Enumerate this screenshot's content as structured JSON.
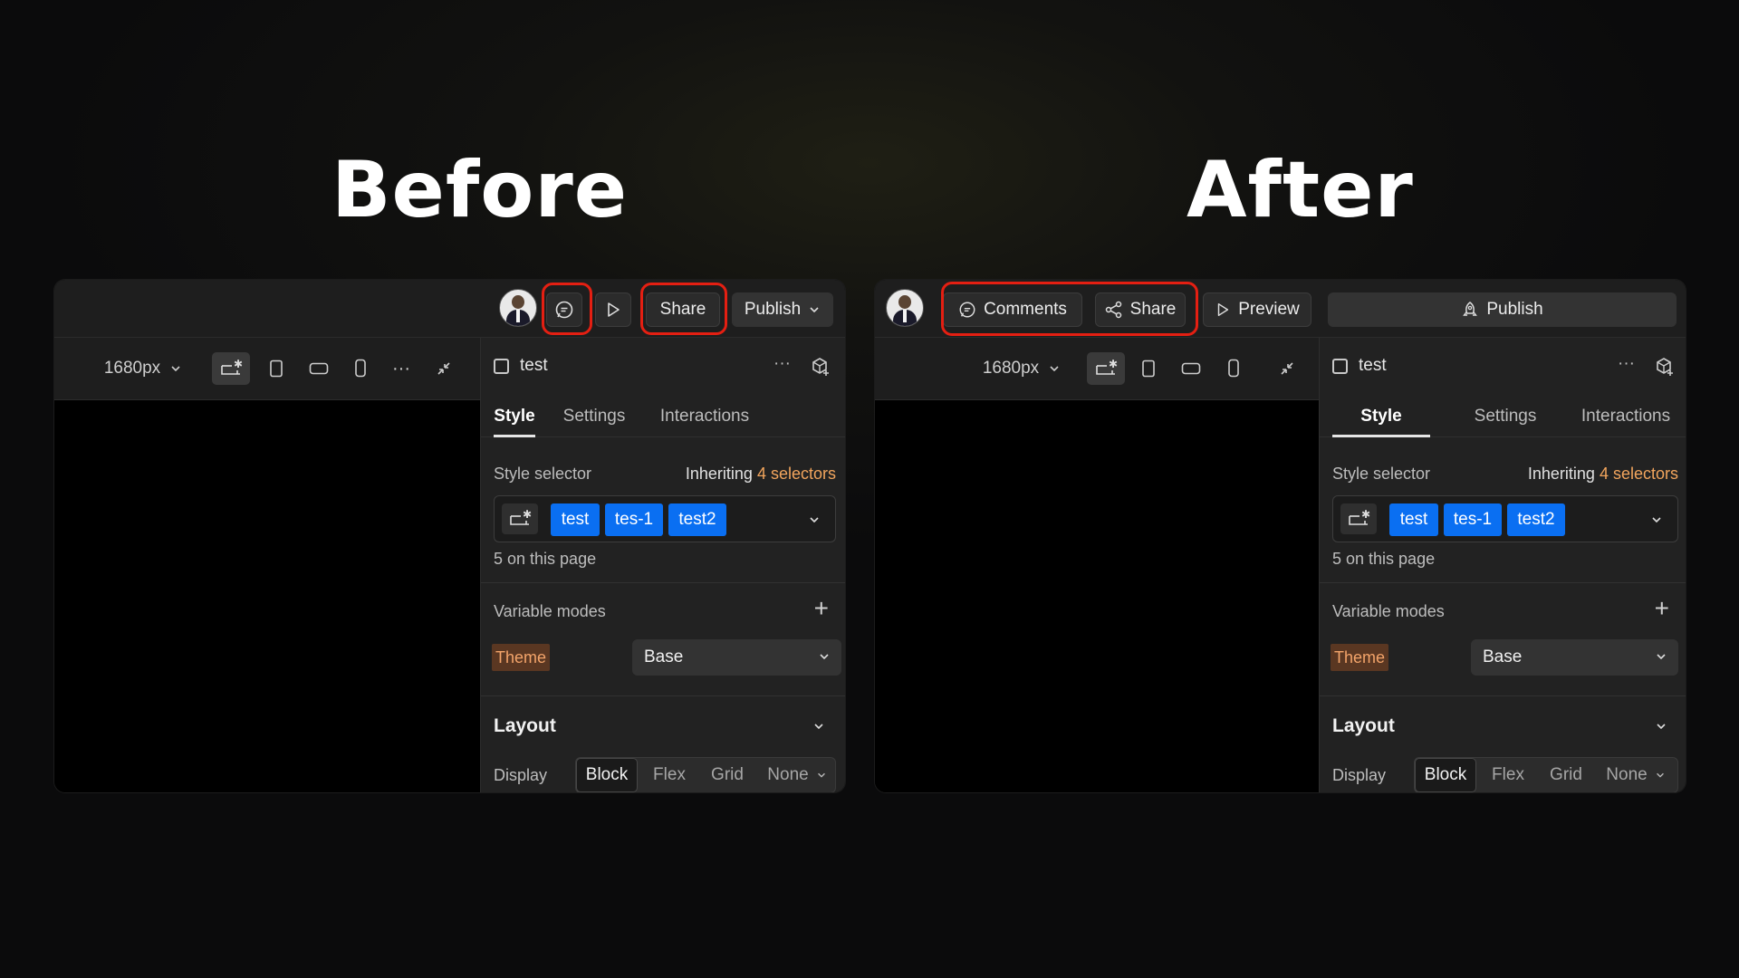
{
  "headings": {
    "before": "Before",
    "after": "After"
  },
  "before": {
    "share_label": "Share",
    "publish_label": "Publish",
    "breakpoint": "1680px",
    "element_name": "test",
    "tabs": [
      "Style",
      "Settings",
      "Interactions"
    ],
    "style_selector_label": "Style selector",
    "inheriting_label": "Inheriting",
    "inheriting_count": "4 selectors",
    "chips": [
      "test",
      "tes-1",
      "test2"
    ],
    "page_count": "5 on this page",
    "variable_modes_label": "Variable modes",
    "theme_label": "Theme",
    "theme_value": "Base",
    "layout_label": "Layout",
    "display_label": "Display",
    "display_options": [
      "Block",
      "Flex",
      "Grid",
      "None"
    ]
  },
  "after": {
    "comments_label": "Comments",
    "share_label": "Share",
    "preview_label": "Preview",
    "publish_label": "Publish",
    "breakpoint": "1680px",
    "element_name": "test",
    "tabs": [
      "Style",
      "Settings",
      "Interactions"
    ],
    "style_selector_label": "Style selector",
    "inheriting_label": "Inheriting",
    "inheriting_count": "4 selectors",
    "chips": [
      "test",
      "tes-1",
      "test2"
    ],
    "page_count": "5 on this page",
    "variable_modes_label": "Variable modes",
    "theme_label": "Theme",
    "theme_value": "Base",
    "layout_label": "Layout",
    "display_label": "Display",
    "display_options": [
      "Block",
      "Flex",
      "Grid",
      "None"
    ]
  },
  "colors": {
    "highlight": "#e41f12",
    "chip": "#0a6ff2",
    "accent": "#f2a55d",
    "theme_tag": "#5a3722"
  }
}
